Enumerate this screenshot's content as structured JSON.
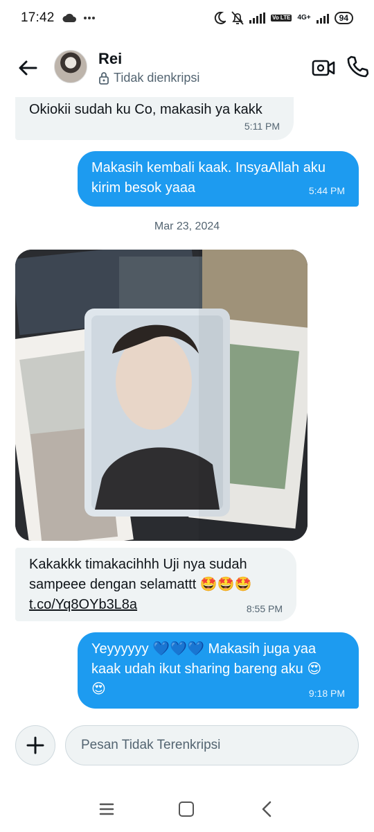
{
  "status_bar": {
    "time": "17:42",
    "left_icons": [
      "cloud-icon",
      "more-dots-icon"
    ],
    "right_icons": [
      "moon-icon",
      "bell-off-icon",
      "signal-icon",
      "volte-icon",
      "network-icon"
    ],
    "volte": "Vo LTE",
    "network": "4G+",
    "battery": "94"
  },
  "header": {
    "contact_name": "Rei",
    "encryption_status": "Tidak dienkripsi",
    "icons": [
      "back-arrow-icon",
      "lock-icon",
      "video-call-icon",
      "phone-icon"
    ]
  },
  "messages": [
    {
      "direction": "incoming",
      "text": "Okiokii sudah ku Co, makasih ya kakk",
      "time": "5:11 PM"
    },
    {
      "direction": "outgoing",
      "text": "Makasih kembali kaak. InsyaAllah aku kirim besok yaaa",
      "time": "5:44 PM"
    }
  ],
  "date_separator": "Mar 23, 2024",
  "media": {
    "type": "photo",
    "description_icon": "image-icon"
  },
  "messages_after": [
    {
      "direction": "incoming",
      "text_line1": "Kakakkk timakacihhh Uji nya sudah",
      "text_line2": "sampeee dengan selamattt 🤩🤩🤩",
      "link": "t.co/Yq8OYb3L8a",
      "time": "8:55 PM"
    },
    {
      "direction": "outgoing",
      "text_line1": "Yeyyyyyy 💙💙💙 Makasih juga yaa",
      "text_line2": "kaak udah ikut sharing bareng aku 😍",
      "text_line3": "😍",
      "time": "9:18 PM"
    }
  ],
  "composer": {
    "placeholder": "Pesan Tidak Terenkripsi"
  },
  "colors": {
    "outgoing_bubble": "#1d9bf0",
    "incoming_bubble": "#eff3f4",
    "secondary_text": "#536471"
  }
}
